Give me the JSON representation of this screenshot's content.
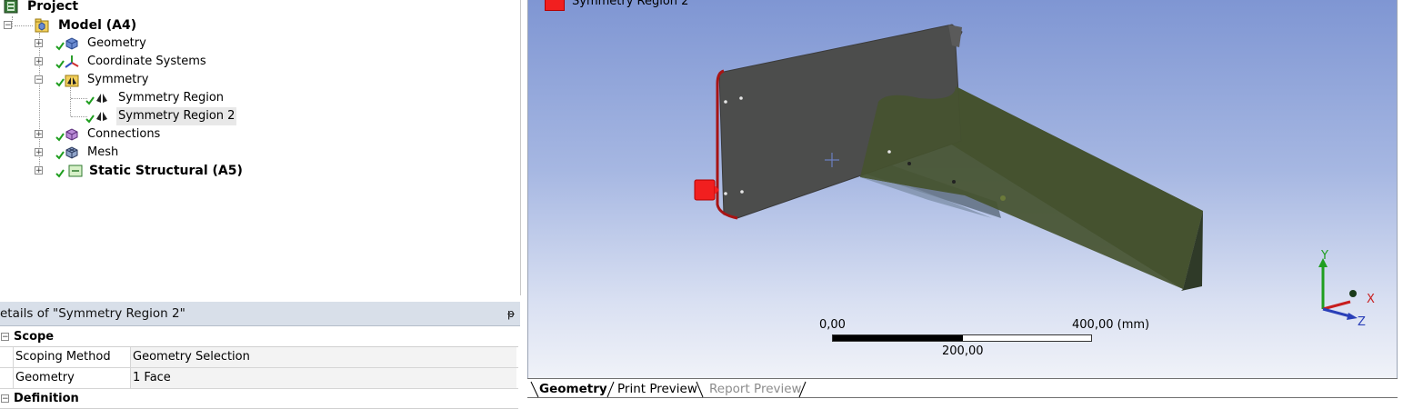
{
  "tree": {
    "project": "Project",
    "model": "Model (A4)",
    "geometry": "Geometry",
    "coordinate_systems": "Coordinate Systems",
    "symmetry": "Symmetry",
    "symmetry_region": "Symmetry Region",
    "symmetry_region_2": "Symmetry Region 2",
    "connections": "Connections",
    "mesh": "Mesh",
    "static_structural": "Static Structural (A5)"
  },
  "details": {
    "title": "etails of \"Symmetry Region 2\"",
    "pin": "ᵽ",
    "scope_section": "Scope",
    "rows": [
      {
        "key": "Scoping Method",
        "value": "Geometry Selection"
      },
      {
        "key": "Geometry",
        "value": "1 Face"
      }
    ],
    "definition_section": "Definition"
  },
  "viewport": {
    "legend_label": "Symmetry Region 2",
    "legend_color": "#f11f1f",
    "scale": {
      "left": "0,00",
      "mid": "200,00",
      "right": "400,00 (mm)"
    },
    "triad": {
      "x": "X",
      "y": "Y",
      "z": "Z"
    }
  },
  "tabs": [
    {
      "label": "Geometry",
      "state": "active"
    },
    {
      "label": "Print Preview",
      "state": "normal"
    },
    {
      "label": "Report Preview",
      "state": "disabled"
    }
  ],
  "colors": {
    "check": "#1f9e1f",
    "symmetry_face": "#f11f1f",
    "highlight": "#e8e8e8"
  }
}
